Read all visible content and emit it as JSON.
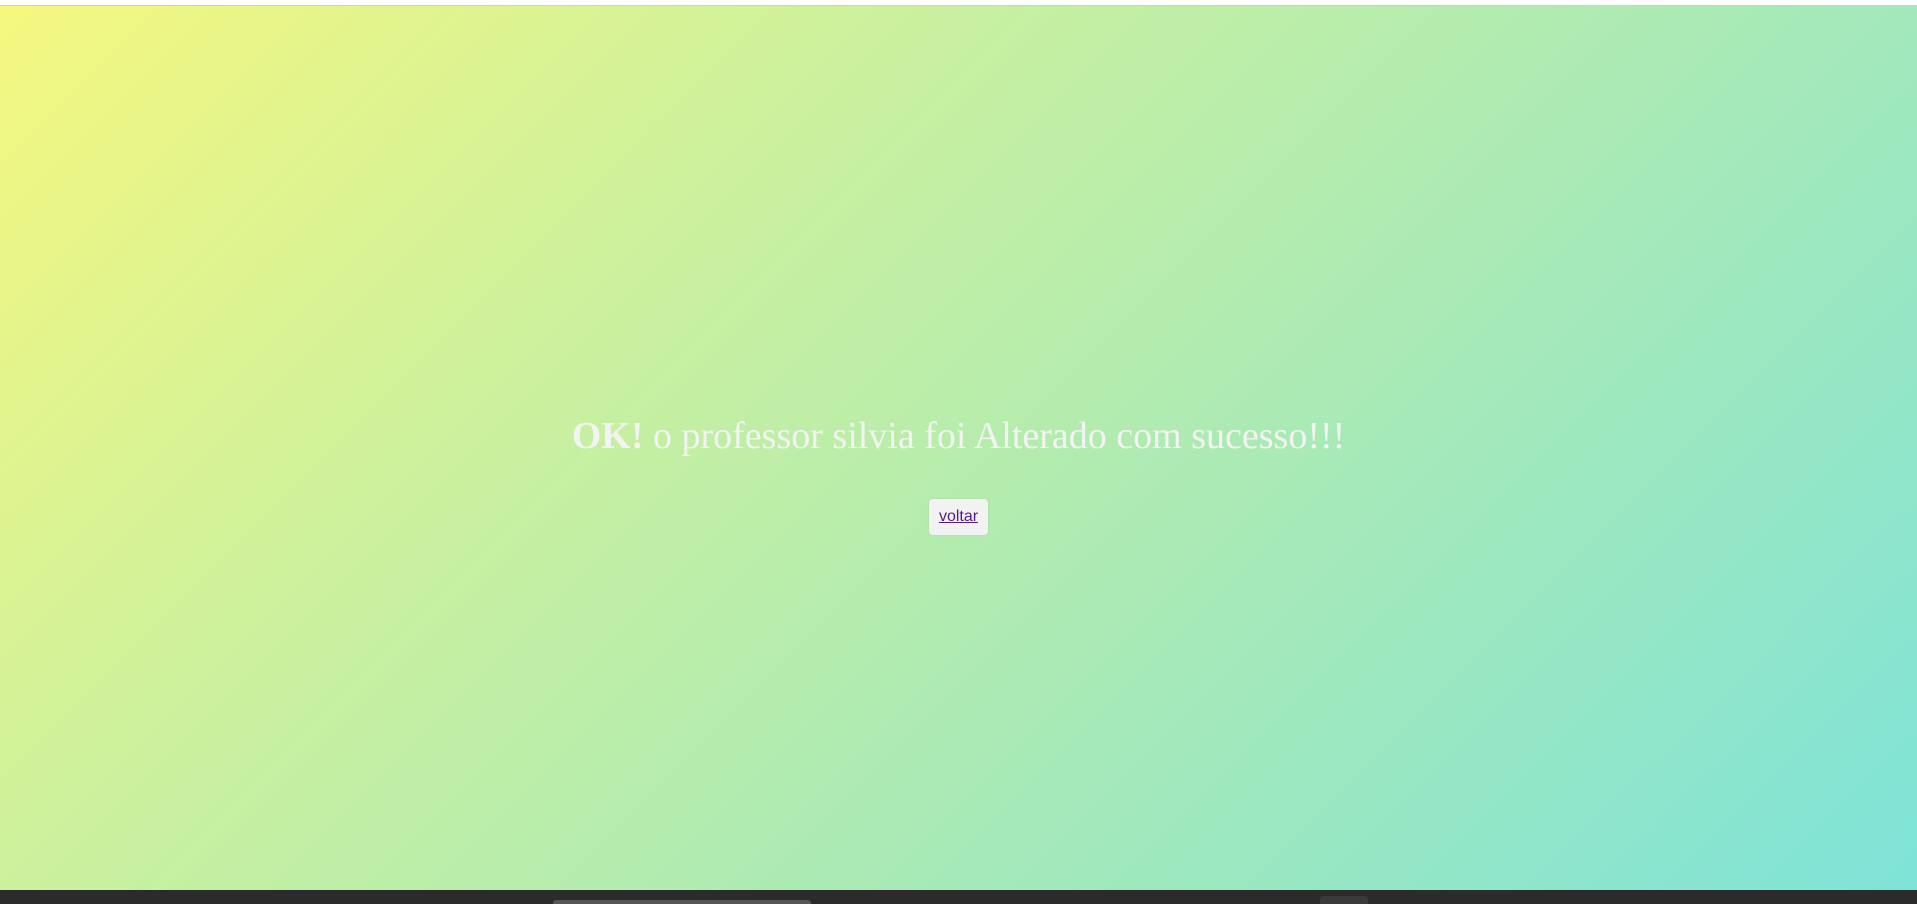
{
  "message": {
    "strong": "OK!",
    "text": " o professor silvia foi Alterado com sucesso!!!"
  },
  "actions": {
    "back_label": "voltar"
  },
  "colors": {
    "gradient_start": "#f5f77f",
    "gradient_end": "#7ee3d8",
    "link": "#551a8b",
    "message_text": "#f3f3f3"
  }
}
